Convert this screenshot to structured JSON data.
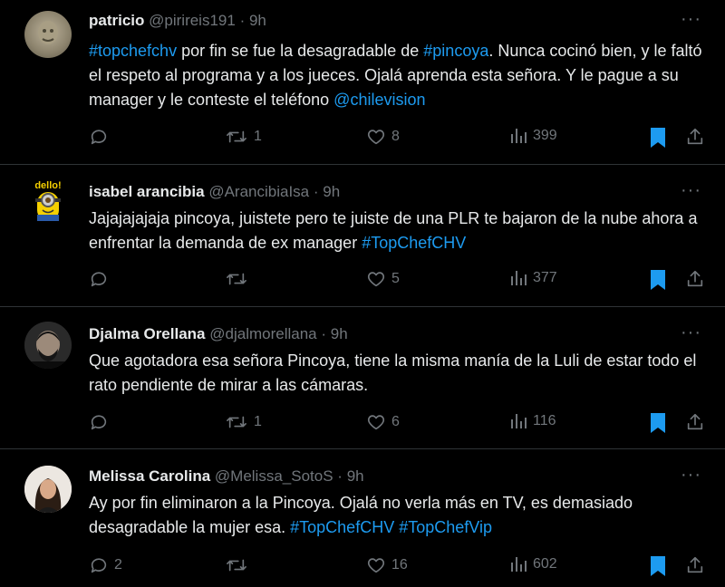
{
  "colors": {
    "background": "#000000",
    "text": "#e7e9ea",
    "muted": "#71767b",
    "link": "#1d9bf0",
    "bookmark": "#1d9bf0",
    "divider": "#2f3336"
  },
  "more_label": "···",
  "tweets": [
    {
      "name": "patricio",
      "handle": "@pirireis191",
      "dot": "·",
      "time": "9h",
      "text_parts": [
        "#topchefchv",
        " por fin se fue la desagradable de ",
        "#pincoya",
        ". Nunca cocinó bien, y le faltó el respeto al programa y a los jueces. Ojalá aprenda esta señora. Y le pague a su manager y le conteste el teléfono ",
        "@chilevision"
      ],
      "replies": "",
      "reposts": "1",
      "likes": "8",
      "views": "399"
    },
    {
      "name": "isabel arancibia",
      "handle": "@ArancibiaIsa",
      "dot": "·",
      "time": "9h",
      "avatar_text": "dello!",
      "text_parts": [
        "Jajajajajaja pincoya, juistete pero te juiste de una  PLR te bajaron de la nube ahora a enfrentar la demanda de ex manager  ",
        "#TopChefCHV"
      ],
      "replies": "",
      "reposts": "",
      "likes": "5",
      "views": "377"
    },
    {
      "name": "Djalma Orellana",
      "handle": "@djalmorellana",
      "dot": "·",
      "time": "9h",
      "text_parts": [
        "Que agotadora esa señora Pincoya, tiene la misma manía de la Luli de estar todo el rato pendiente de mirar a las cámaras."
      ],
      "replies": "",
      "reposts": "1",
      "likes": "6",
      "views": "116"
    },
    {
      "name": "Melissa Carolina",
      "handle": "@Melissa_SotoS",
      "dot": "·",
      "time": "9h",
      "text_parts": [
        "Ay por fin eliminaron a la Pincoya. Ojalá no verla más en TV, es demasiado desagradable la mujer esa. ",
        "#TopChefCHV",
        " ",
        "#TopChefVip"
      ],
      "replies": "2",
      "reposts": "",
      "likes": "16",
      "views": "602"
    }
  ],
  "icons": {
    "reply": "reply-icon",
    "repost": "repost-icon",
    "like": "heart-icon",
    "views": "views-icon",
    "bookmark": "bookmark-icon",
    "share": "share-icon",
    "more": "more-icon"
  }
}
